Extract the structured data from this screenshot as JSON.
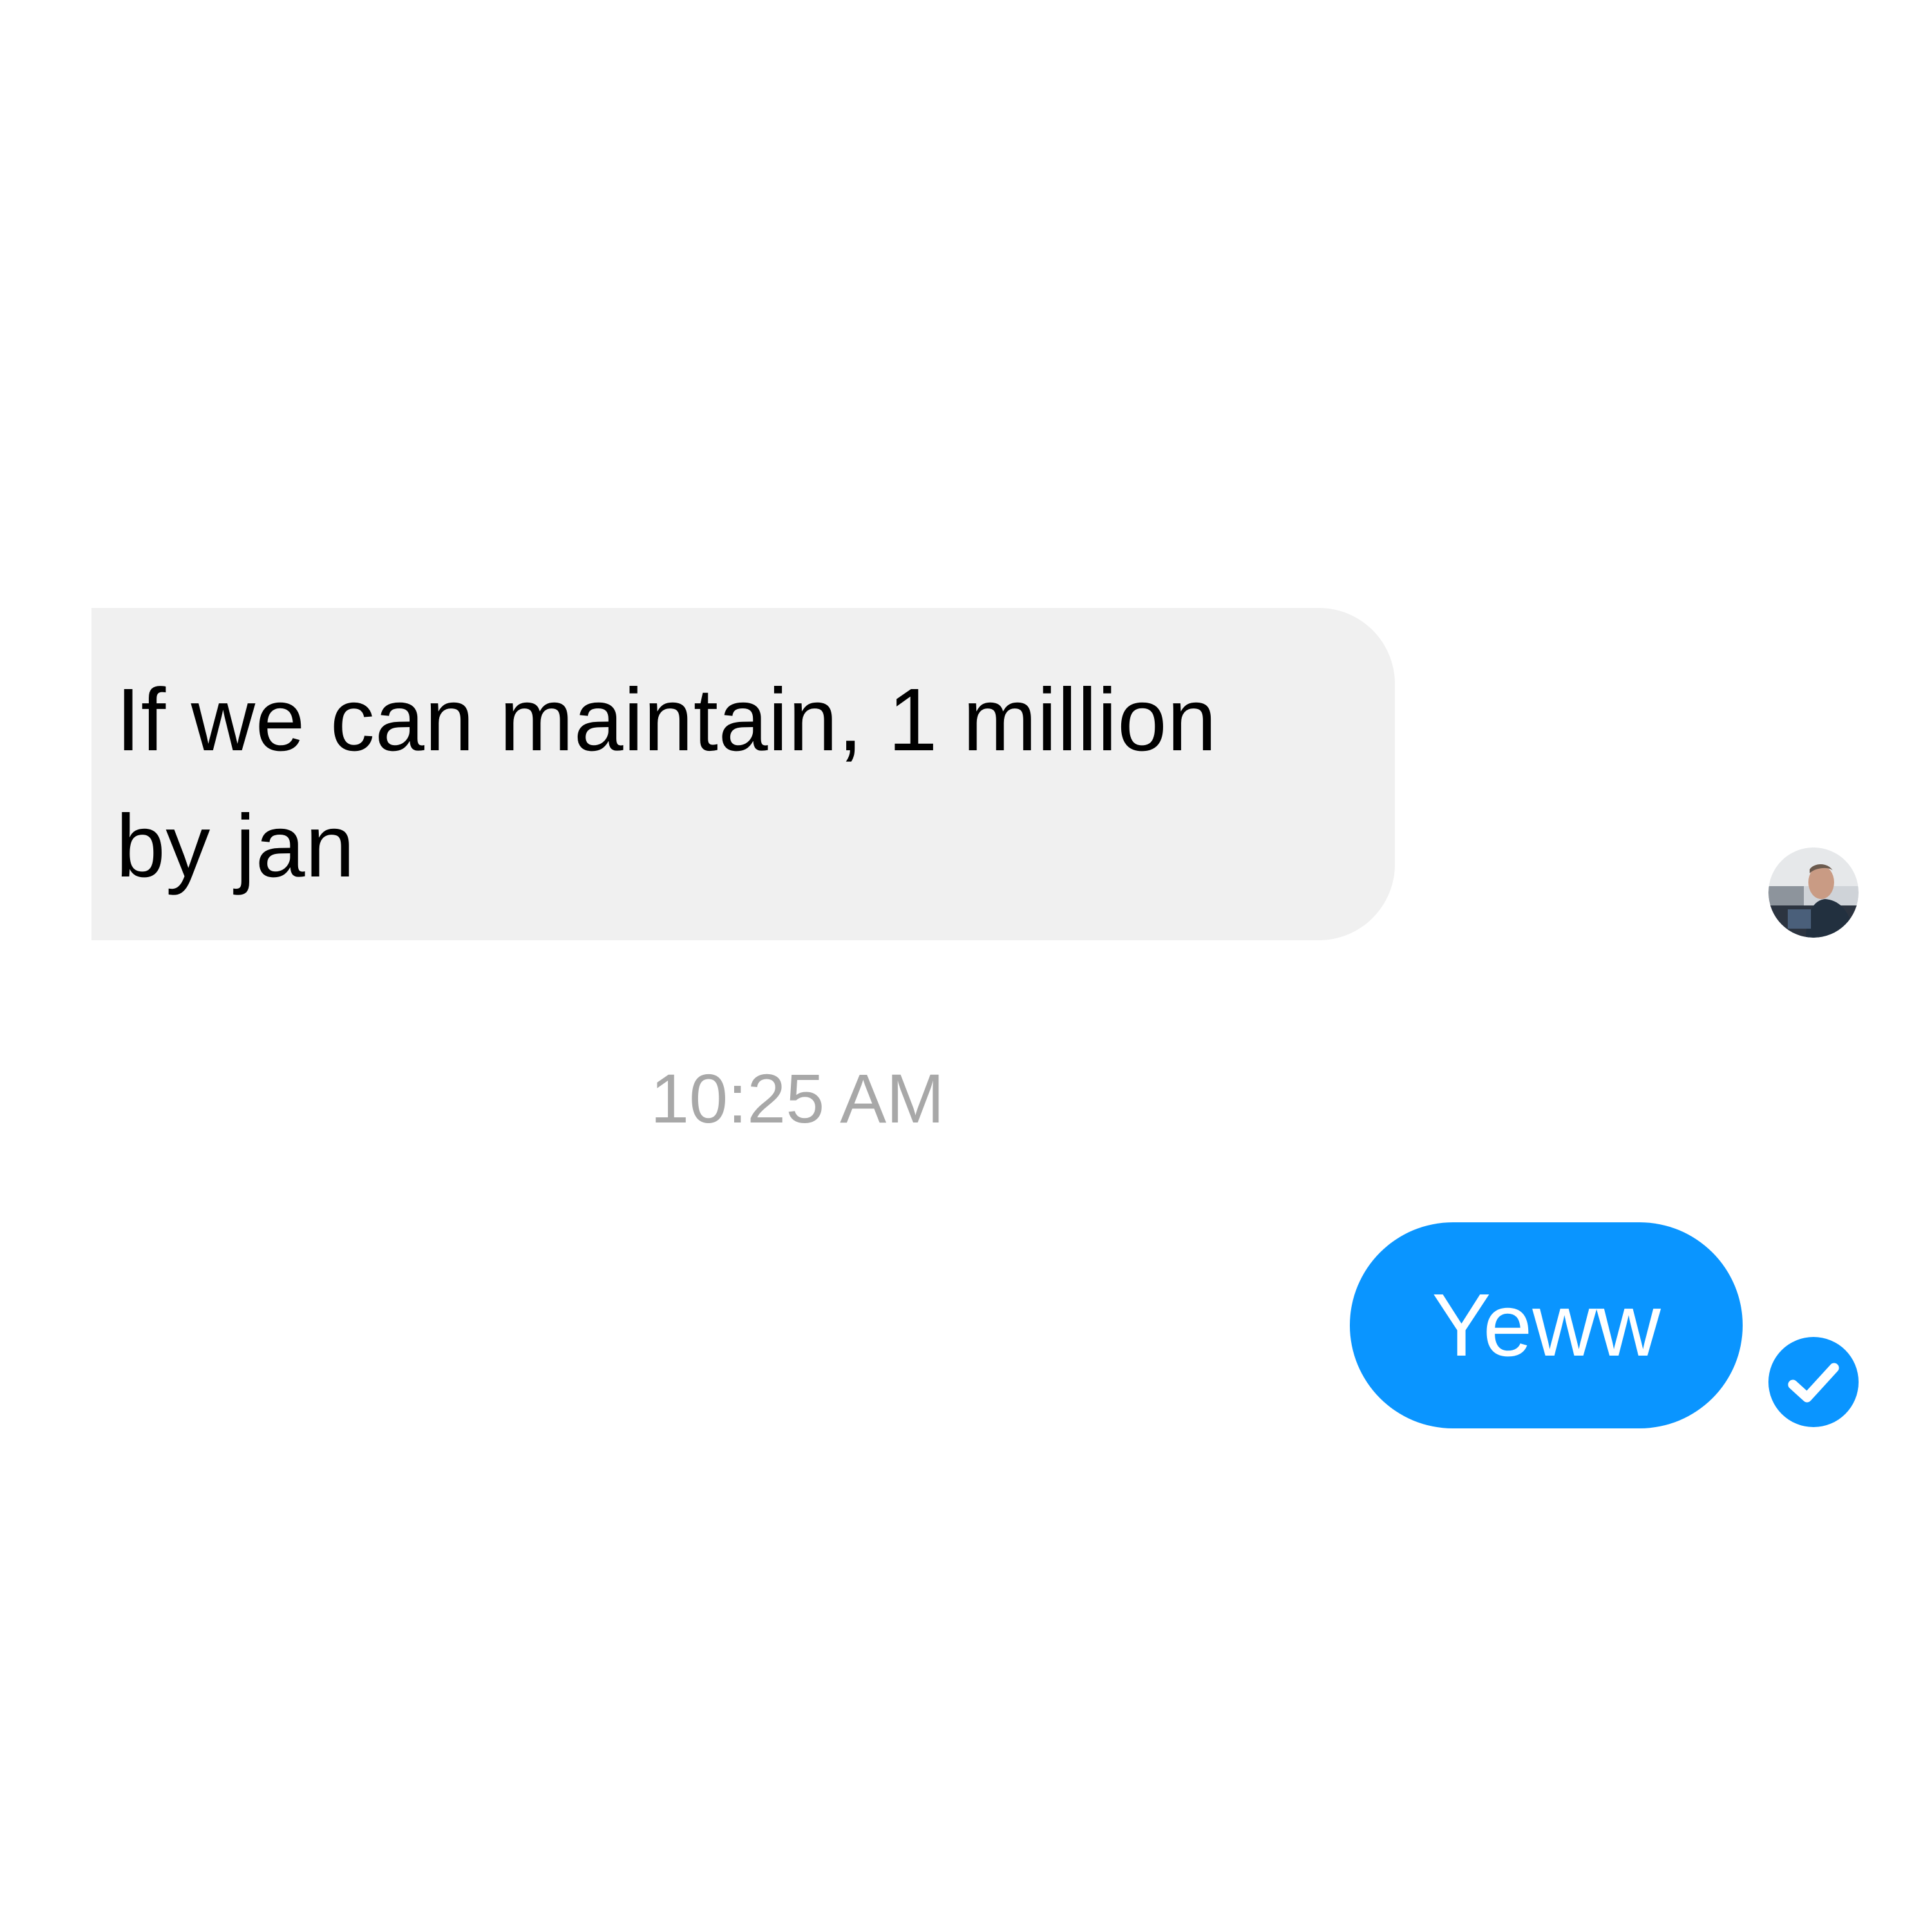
{
  "conversation": {
    "incoming_message": {
      "text": "If we can maintain, 1 million\nby jan"
    },
    "read_receipt": {
      "icon": "avatar"
    },
    "timestamp": "10:25 AM",
    "outgoing_message": {
      "text": "Yeww",
      "status_icon": "delivered-check-icon"
    }
  },
  "colors": {
    "incoming_bubble": "#f0f0f0",
    "outgoing_bubble": "#0a95ff",
    "timestamp_text": "#a8a8a8",
    "delivered_check": "#0a95ff"
  }
}
